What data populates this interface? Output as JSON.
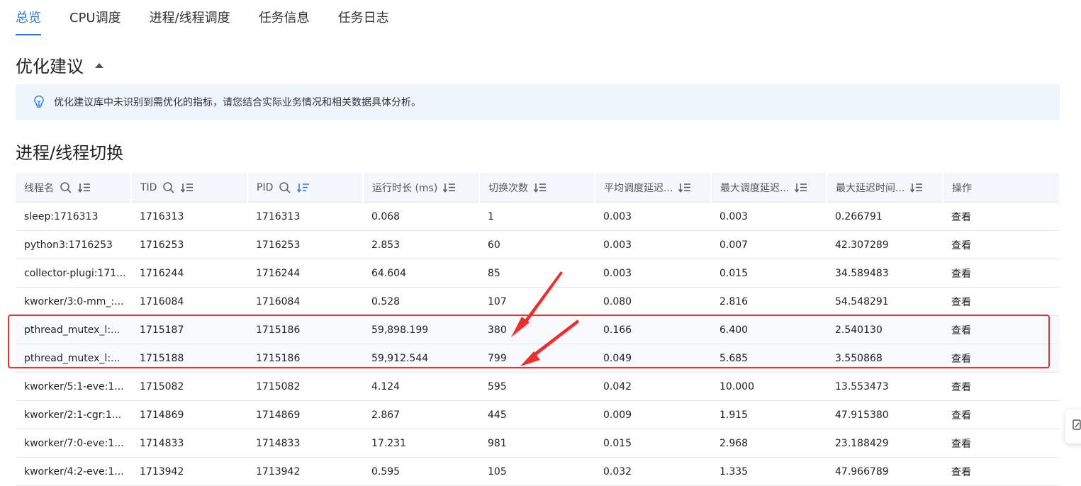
{
  "tabs": [
    {
      "label": "总览",
      "active": true
    },
    {
      "label": "CPU调度",
      "active": false
    },
    {
      "label": "进程/线程调度",
      "active": false
    },
    {
      "label": "任务信息",
      "active": false
    },
    {
      "label": "任务日志",
      "active": false
    }
  ],
  "optimization": {
    "title": "优化建议",
    "message": "优化建议库中未识别到需优化的指标，请您结合实际业务情况和相关数据具体分析。"
  },
  "switch_section": {
    "title": "进程/线程切换",
    "columns": [
      "线程名",
      "TID",
      "PID",
      "运行时长 (ms)",
      "切换次数",
      "平均调度延迟...",
      "最大调度延迟...",
      "最大延迟时间...",
      "操作"
    ],
    "rows": [
      {
        "name": "sleep:1716313",
        "tid": "1716313",
        "pid": "1716313",
        "runtime": "0.068",
        "switches": "1",
        "avg_delay": "0.003",
        "max_delay": "0.003",
        "max_time": "0.266791",
        "action": "查看"
      },
      {
        "name": "python3:1716253",
        "tid": "1716253",
        "pid": "1716253",
        "runtime": "2.853",
        "switches": "60",
        "avg_delay": "0.003",
        "max_delay": "0.007",
        "max_time": "42.307289",
        "action": "查看"
      },
      {
        "name": "collector-plugi:171...",
        "tid": "1716244",
        "pid": "1716244",
        "runtime": "64.604",
        "switches": "85",
        "avg_delay": "0.003",
        "max_delay": "0.015",
        "max_time": "34.589483",
        "action": "查看"
      },
      {
        "name": "kworker/3:0-mm_:...",
        "tid": "1716084",
        "pid": "1716084",
        "runtime": "0.528",
        "switches": "107",
        "avg_delay": "0.080",
        "max_delay": "2.816",
        "max_time": "54.548291",
        "action": "查看"
      },
      {
        "name": "pthread_mutex_l:...",
        "tid": "1715187",
        "pid": "1715186",
        "runtime": "59,898.199",
        "switches": "380",
        "avg_delay": "0.166",
        "max_delay": "6.400",
        "max_time": "2.540130",
        "action": "查看"
      },
      {
        "name": "pthread_mutex_l:...",
        "tid": "1715188",
        "pid": "1715186",
        "runtime": "59,912.544",
        "switches": "799",
        "avg_delay": "0.049",
        "max_delay": "5.685",
        "max_time": "3.550868",
        "action": "查看"
      },
      {
        "name": "kworker/5:1-eve:1...",
        "tid": "1715082",
        "pid": "1715082",
        "runtime": "4.124",
        "switches": "595",
        "avg_delay": "0.042",
        "max_delay": "10.000",
        "max_time": "13.553473",
        "action": "查看"
      },
      {
        "name": "kworker/2:1-cgr:1...",
        "tid": "1714869",
        "pid": "1714869",
        "runtime": "2.867",
        "switches": "445",
        "avg_delay": "0.009",
        "max_delay": "1.915",
        "max_time": "47.915380",
        "action": "查看"
      },
      {
        "name": "kworker/7:0-eve:1...",
        "tid": "1714833",
        "pid": "1714833",
        "runtime": "17.231",
        "switches": "981",
        "avg_delay": "0.015",
        "max_delay": "2.968",
        "max_time": "23.188429",
        "action": "查看"
      },
      {
        "name": "kworker/4:2-eve:1...",
        "tid": "1713942",
        "pid": "1713942",
        "runtime": "0.595",
        "switches": "105",
        "avg_delay": "0.032",
        "max_delay": "1.335",
        "max_time": "47.966789",
        "action": "查看"
      }
    ]
  },
  "colors": {
    "accent": "#2a7ae2",
    "highlight": "#ef2d2d"
  },
  "icons": [
    "bulb-icon",
    "search-icon",
    "sort-icon",
    "sort-active-icon",
    "caret-up-icon",
    "feedback-icon"
  ]
}
